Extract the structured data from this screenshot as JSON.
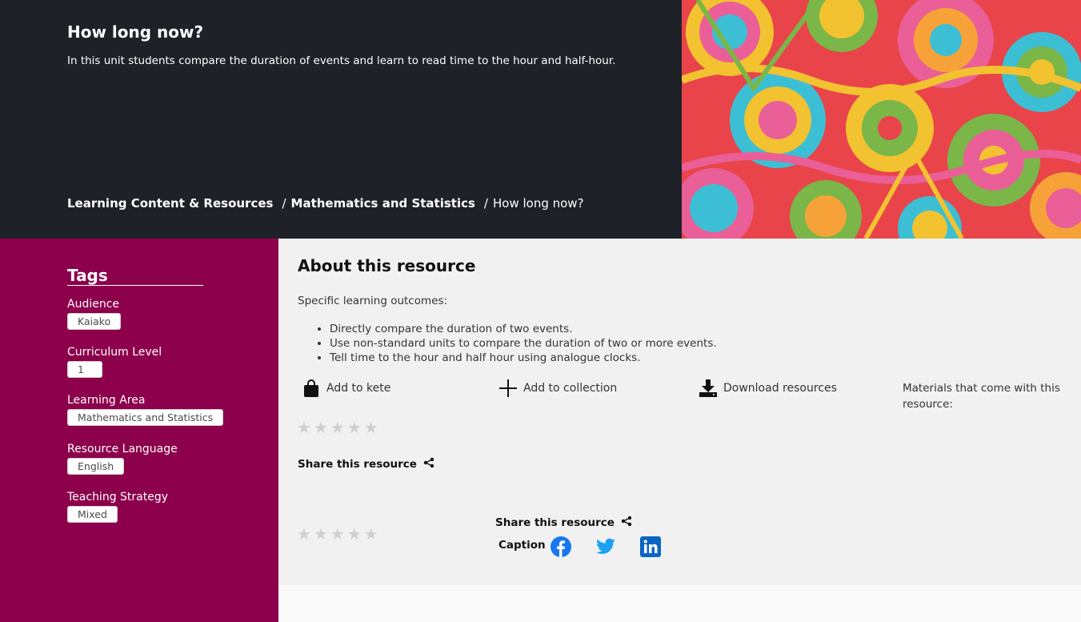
{
  "hero": {
    "title": "How long now?",
    "description": "In this unit students compare the duration of events and learn to read time to the hour and half-hour."
  },
  "breadcrumb": [
    {
      "label": "Learning Content & Resources"
    },
    {
      "label": "Mathematics and Statistics"
    },
    {
      "label": "How long now?"
    }
  ],
  "breadcrumb_separator": "/",
  "tags": {
    "heading": "Tags",
    "groups": [
      {
        "label": "Audience",
        "value": "Kaiako"
      },
      {
        "label": "Curriculum Level",
        "value": "1"
      },
      {
        "label": "Learning Area",
        "value": "Mathematics and Statistics"
      },
      {
        "label": "Resource Language",
        "value": "English"
      },
      {
        "label": "Teaching Strategy",
        "value": "Mixed"
      }
    ]
  },
  "about": {
    "heading": "About this resource",
    "outcomes_label": "Specific learning outcomes:",
    "outcomes": [
      "Directly compare the duration of two events.",
      "Use non-standard units to compare the duration of two or more events.",
      "Tell time to the hour and half hour using analogue clocks."
    ]
  },
  "actions": {
    "add_to_kete": "Add to kete",
    "add_to_collection": "Add to collection",
    "download_resources": "Download resources",
    "materials": "Materials that come with this resource:"
  },
  "rating": {
    "value": 0,
    "max": 5
  },
  "share": {
    "label": "Share this resource",
    "caption": "Caption"
  },
  "colors": {
    "hero_bg": "#1f2129",
    "sidebar_bg": "#8c004c",
    "panel_bg": "#f1f1f1",
    "facebook": "#1877f2",
    "twitter": "#1da1f2",
    "linkedin": "#0a66c2"
  },
  "icons": [
    "shopping-bag-icon",
    "plus-icon",
    "download-icon",
    "star-icon",
    "share-icon",
    "facebook-icon",
    "twitter-icon",
    "linkedin-icon"
  ]
}
